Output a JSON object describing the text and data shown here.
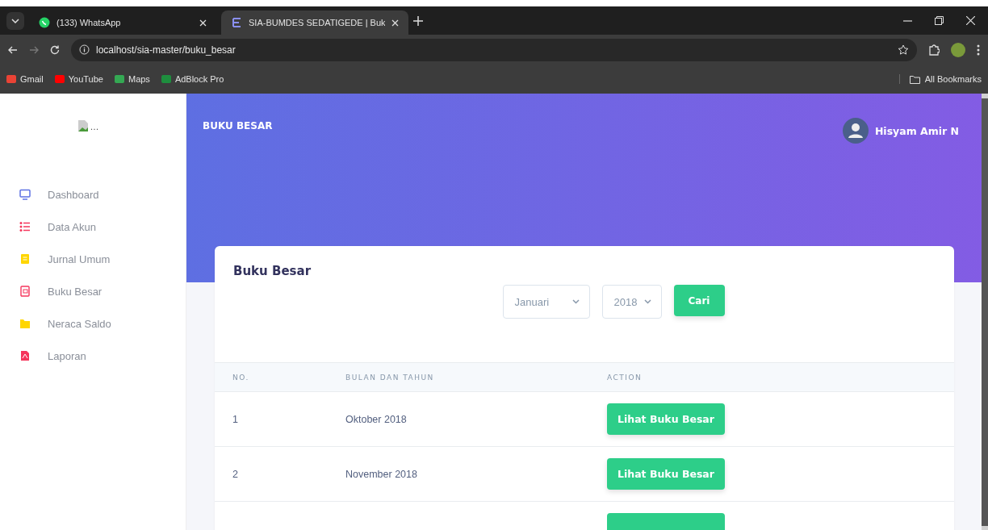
{
  "browser": {
    "tabs": [
      {
        "title": "(133) WhatsApp",
        "kind": "chat",
        "selected": false
      },
      {
        "title": "SIA-BUMDES SEDATIGEDE | Buk",
        "kind": "site",
        "selected": true
      }
    ],
    "url": "localhost/sia-master/buku_besar",
    "bookmarks": [
      {
        "label": "Gmail"
      },
      {
        "label": "YouTube"
      },
      {
        "label": "Maps"
      },
      {
        "label": "AdBlock Pro"
      }
    ],
    "all_bookmarks": "All Bookmarks"
  },
  "sidebar": {
    "logo_alt": "...",
    "items": [
      {
        "label": "Dashboard"
      },
      {
        "label": "Data Akun"
      },
      {
        "label": "Jurnal Umum"
      },
      {
        "label": "Buku Besar"
      },
      {
        "label": "Neraca Saldo"
      },
      {
        "label": "Laporan"
      }
    ]
  },
  "header": {
    "title": "BUKU BESAR",
    "user": "Hisyam Amir N"
  },
  "card": {
    "title": "Buku Besar",
    "month": "Januari",
    "year": "2018",
    "search_button": "Cari",
    "table": {
      "columns": [
        "NO.",
        "BULAN DAN TAHUN",
        "ACTION"
      ],
      "rows": [
        {
          "kind": "full",
          "no": "1",
          "period": "Oktober 2018",
          "action": "Lihat Buku Besar"
        },
        {
          "kind": "full",
          "no": "2",
          "period": "November 2018",
          "action": "Lihat Buku Besar"
        },
        {
          "kind": "cut_off"
        }
      ]
    }
  }
}
